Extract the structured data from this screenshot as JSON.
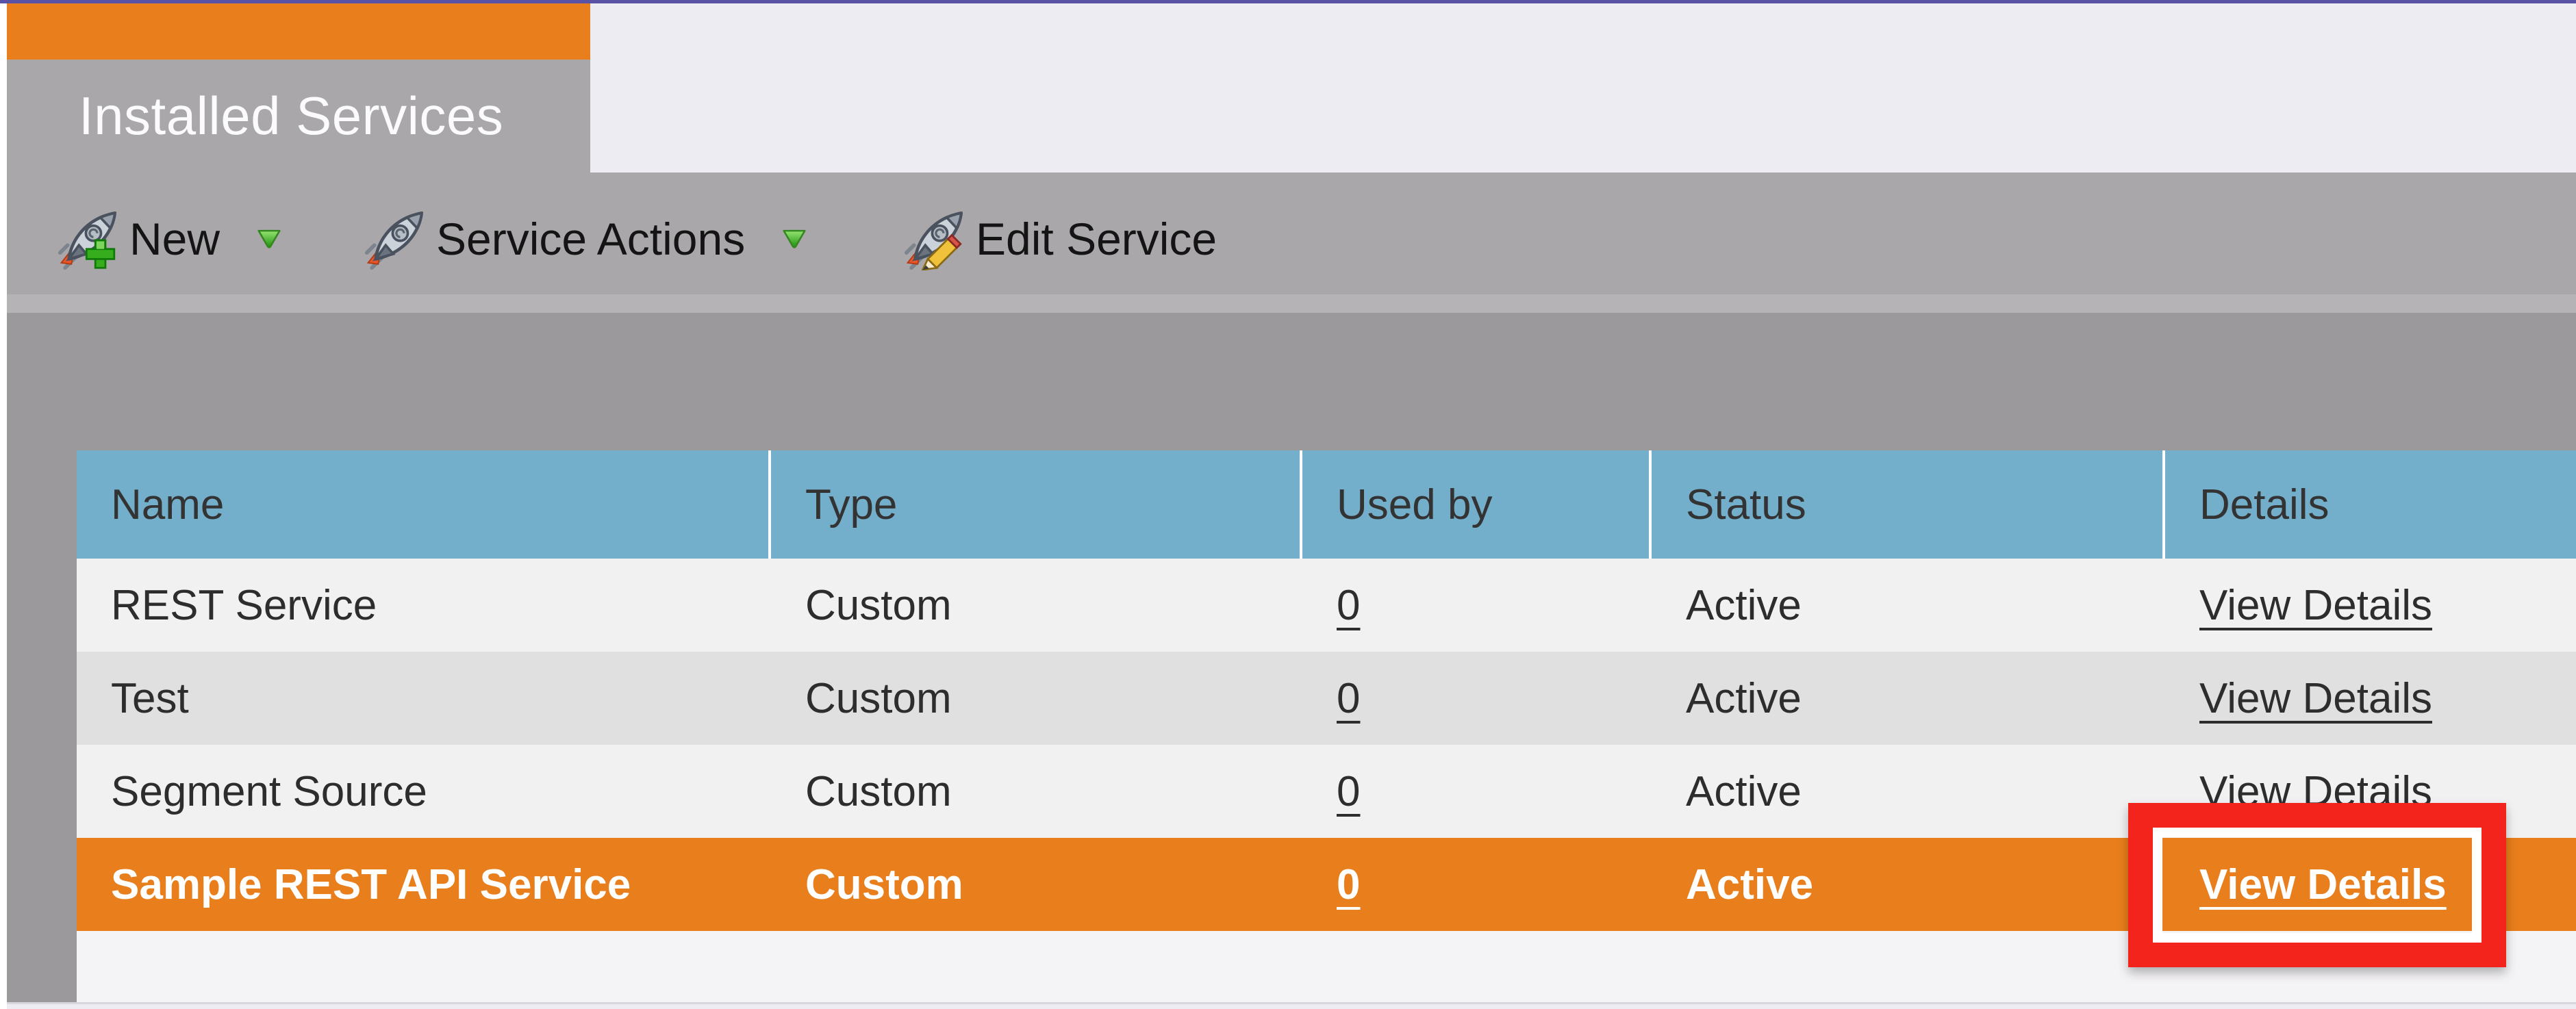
{
  "window": {
    "top_border_color": "#5a52a5",
    "content_background": "#9b999c",
    "panel_background": "#edecf2"
  },
  "tab": {
    "title": "Installed Services",
    "accent_color": "#e87e1c"
  },
  "toolbar": {
    "buttons": [
      {
        "label": "New",
        "icon": "rocket-plus",
        "has_dropdown": true
      },
      {
        "label": "Service Actions",
        "icon": "rocket",
        "has_dropdown": true
      },
      {
        "label": "Edit Service",
        "icon": "rocket-pencil",
        "has_dropdown": false
      }
    ],
    "dropdown_arrow_color": "#2f9d18"
  },
  "table": {
    "header_color": "#73aeca",
    "selected_row_color": "#e87e1c",
    "columns": [
      "Name",
      "Type",
      "Used by",
      "Status",
      "Details"
    ],
    "rows": [
      {
        "name": "REST Service",
        "type": "Custom",
        "used_by": "0",
        "status": "Active",
        "details": "View Details",
        "selected": false
      },
      {
        "name": "Test",
        "type": "Custom",
        "used_by": "0",
        "status": "Active",
        "details": "View Details",
        "selected": false
      },
      {
        "name": "Segment Source",
        "type": "Custom",
        "used_by": "0",
        "status": "Active",
        "details": "View Details",
        "selected": false
      },
      {
        "name": "Sample REST API Service",
        "type": "Custom",
        "used_by": "0",
        "status": "Active",
        "details": "View Details",
        "selected": true
      }
    ]
  },
  "annotation": {
    "type": "rectangle-highlight",
    "color": "#f3241b",
    "target": "View Details"
  }
}
